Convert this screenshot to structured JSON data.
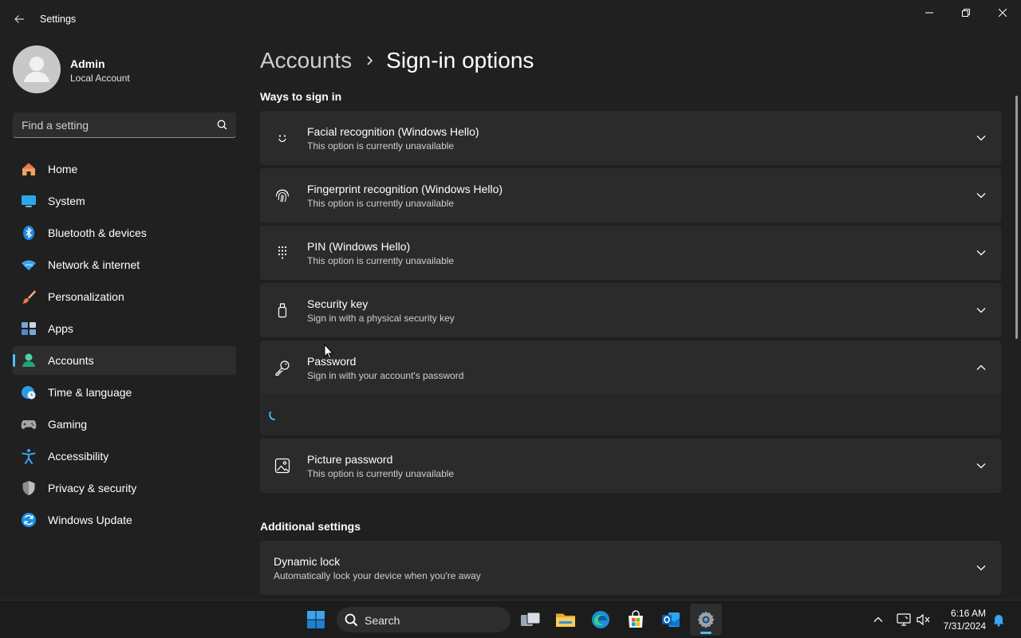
{
  "window": {
    "title": "Settings",
    "back_icon": "arrow-left-icon",
    "controls": [
      "minimize-icon",
      "restore-icon",
      "close-icon"
    ]
  },
  "profile": {
    "name": "Admin",
    "account_type": "Local Account"
  },
  "search": {
    "placeholder": "Find a setting"
  },
  "sidebar": {
    "items": [
      {
        "label": "Home",
        "icon": "home-icon"
      },
      {
        "label": "System",
        "icon": "monitor-icon"
      },
      {
        "label": "Bluetooth & devices",
        "icon": "bluetooth-icon"
      },
      {
        "label": "Network & internet",
        "icon": "wifi-icon"
      },
      {
        "label": "Personalization",
        "icon": "brush-icon"
      },
      {
        "label": "Apps",
        "icon": "apps-icon"
      },
      {
        "label": "Accounts",
        "icon": "person-icon",
        "active": true
      },
      {
        "label": "Time & language",
        "icon": "globe-clock-icon"
      },
      {
        "label": "Gaming",
        "icon": "gamepad-icon"
      },
      {
        "label": "Accessibility",
        "icon": "accessibility-icon"
      },
      {
        "label": "Privacy & security",
        "icon": "shield-icon"
      },
      {
        "label": "Windows Update",
        "icon": "update-icon"
      }
    ]
  },
  "breadcrumb": {
    "parent": "Accounts",
    "current": "Sign-in options"
  },
  "sections": {
    "ways_to_sign_in": "Ways to sign in",
    "additional_settings": "Additional settings"
  },
  "sign_in_options": [
    {
      "title": "Facial recognition (Windows Hello)",
      "subtitle": "This option is currently unavailable",
      "icon": "face-icon",
      "expanded": false
    },
    {
      "title": "Fingerprint recognition (Windows Hello)",
      "subtitle": "This option is currently unavailable",
      "icon": "fingerprint-icon",
      "expanded": false
    },
    {
      "title": "PIN (Windows Hello)",
      "subtitle": "This option is currently unavailable",
      "icon": "keypad-icon",
      "expanded": false
    },
    {
      "title": "Security key",
      "subtitle": "Sign in with a physical security key",
      "icon": "usb-key-icon",
      "expanded": false
    },
    {
      "title": "Password",
      "subtitle": "Sign in with your account's password",
      "icon": "key-icon",
      "expanded": true
    },
    {
      "title": "Picture password",
      "subtitle": "This option is currently unavailable",
      "icon": "image-icon",
      "expanded": false
    }
  ],
  "additional": [
    {
      "title": "Dynamic lock",
      "subtitle": "Automatically lock your device when you're away"
    }
  ],
  "taskbar": {
    "search_label": "Search",
    "apps": [
      "windows-start-icon",
      "search-icon",
      "task-view-icon",
      "file-explorer-icon",
      "edge-icon",
      "store-icon",
      "outlook-icon",
      "settings-icon"
    ],
    "active_app": "settings-icon",
    "time": "6:16 AM",
    "date": "7/31/2024"
  },
  "colors": {
    "accent": "#4cc2ff",
    "background": "#202020",
    "card": "#2b2b2b"
  }
}
